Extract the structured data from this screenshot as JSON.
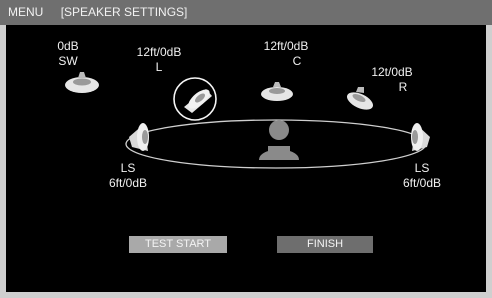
{
  "titlebar": {
    "menu": "MENU",
    "section": "[SPEAKER SETTINGS]"
  },
  "speakers": {
    "sw": {
      "level": "0dB",
      "name": "SW"
    },
    "l": {
      "dist": "12ft/0dB",
      "name": "L"
    },
    "c": {
      "dist": "12ft/0dB",
      "name": "C"
    },
    "r": {
      "dist": "12t/0dB",
      "name": "R"
    },
    "ls_left": {
      "name": "LS",
      "dist": "6ft/0dB"
    },
    "ls_right": {
      "name": "LS",
      "dist": "6ft/0dB"
    }
  },
  "buttons": {
    "test_start": "TEST START",
    "finish": "FINISH"
  },
  "icons": [
    "speaker-icon",
    "listener-icon",
    "selection-ring-icon"
  ]
}
